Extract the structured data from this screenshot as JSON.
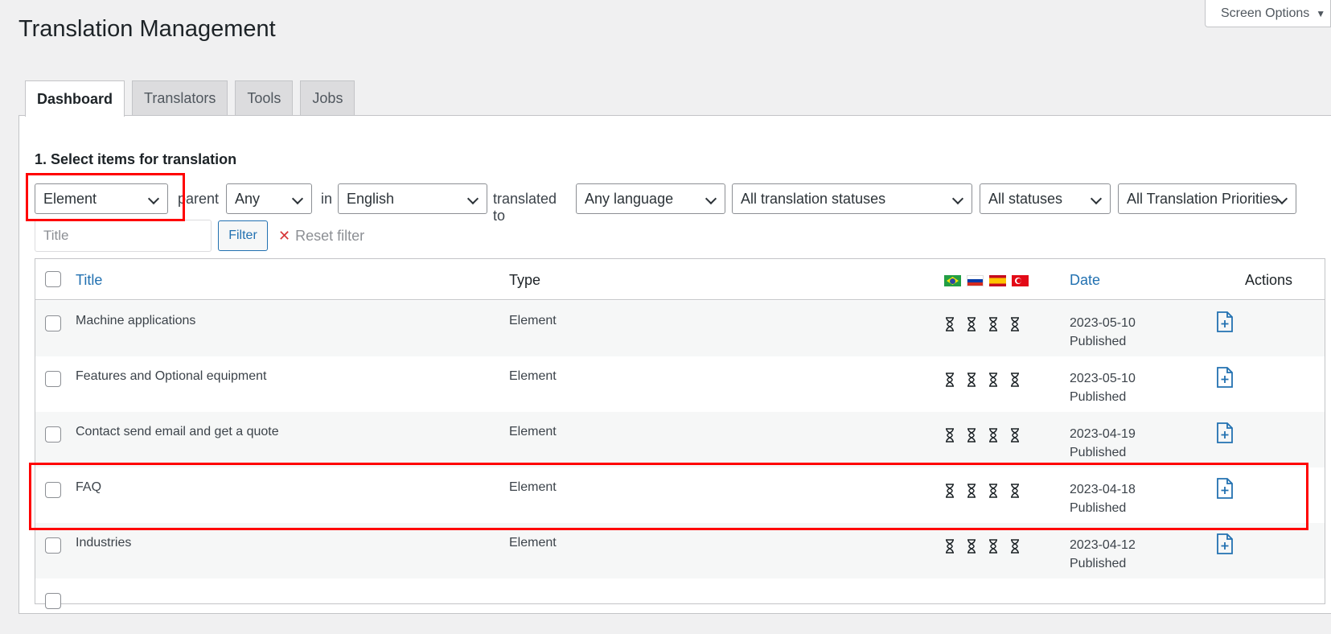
{
  "screen_options": {
    "label": "Screen Options"
  },
  "page_title": "Translation Management",
  "tabs": [
    {
      "label": "Dashboard",
      "active": true
    },
    {
      "label": "Translators",
      "active": false
    },
    {
      "label": "Tools",
      "active": false
    },
    {
      "label": "Jobs",
      "active": false
    }
  ],
  "section_title": "1. Select items for translation",
  "filters": {
    "type_value": "Element",
    "parent_label": "parent",
    "parent_value": "Any",
    "in_label": "in",
    "language_value": "English",
    "translated_to_label": "translated to",
    "target_language_value": "Any language",
    "translation_status_value": "All translation statuses",
    "status_value": "All statuses",
    "priority_value": "All Translation Priorities",
    "title_placeholder": "Title",
    "filter_button": "Filter",
    "reset_filter": "Reset filter"
  },
  "table": {
    "columns": {
      "title": "Title",
      "type": "Type",
      "date": "Date",
      "actions": "Actions"
    },
    "languages": [
      "flag-br",
      "flag-ru",
      "flag-es",
      "flag-tr"
    ],
    "rows": [
      {
        "title": "Machine applications",
        "type": "Element",
        "date": "2023-05-10",
        "status": "Published"
      },
      {
        "title": "Features and Optional equipment",
        "type": "Element",
        "date": "2023-05-10",
        "status": "Published"
      },
      {
        "title": "Contact send email and get a quote",
        "type": "Element",
        "date": "2023-04-19",
        "status": "Published"
      },
      {
        "title": "FAQ",
        "type": "Element",
        "date": "2023-04-18",
        "status": "Published"
      },
      {
        "title": "Industries",
        "type": "Element",
        "date": "2023-04-12",
        "status": "Published"
      }
    ]
  },
  "colors": {
    "link": "#2271b1",
    "highlight": "#ff0000"
  }
}
